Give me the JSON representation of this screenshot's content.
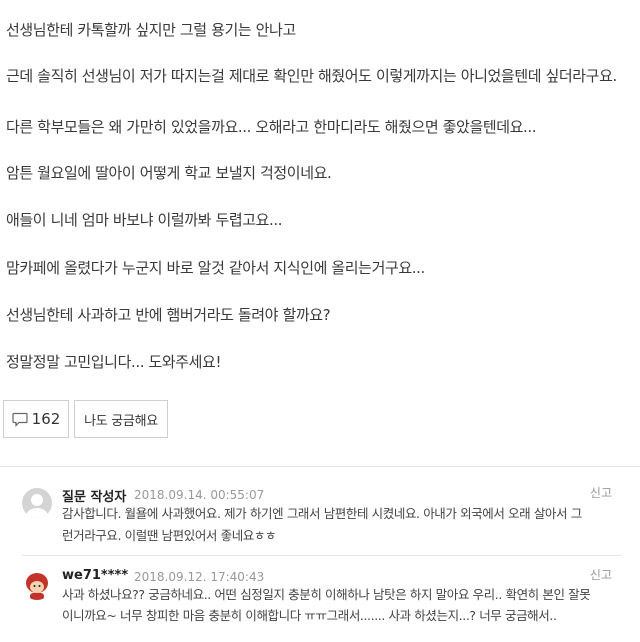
{
  "post": {
    "paragraphs": [
      "선생님한테 카톡할까 싶지만 그럴 용기는 안나고",
      "근데 솔직히 선생님이 저가 따지는걸 제대로 확인만 해줬어도 이렇게까지는 아니었을텐데 싶더라구요.",
      "다른 학부모들은 왜 가만히 있었을까요... 오해라고 한마디라도 해줬으면 좋았을텐데요...",
      "암튼 월요일에 딸아이 어떻게 학교 보낼지 걱정이네요.",
      "애들이 니네 엄마 바보냐 이럴까봐 두렵고요...",
      "맘카페에 올렸다가 누군지 바로 알것 같아서 지식인에 올리는거구요...",
      "선생님한테 사과하고 반에 햄버거라도 돌려야 할까요?",
      "정말정말 고민입니다... 도와주세요!"
    ]
  },
  "actions": {
    "like_icon": "speech-bubble-icon",
    "like_count": "162",
    "curious_label": "나도 궁금해요"
  },
  "comments": [
    {
      "author": "질문 작성자",
      "date": "2018.09.14. 00:55:07",
      "report": "신고",
      "avatar": "default-user-avatar",
      "lines": [
        "감사합니다. 월욜에 사과했어요. 제가 하기엔 그래서 남편한테 시켰네요. 아내가 외국에서 오래 살아서 그",
        "런거라구요. 이럴땐 남편있어서 좋네요ㅎㅎ"
      ]
    },
    {
      "author": "we71****",
      "date": "2018.09.12. 17:40:43",
      "report": "신고",
      "avatar": "character-avatar",
      "lines": [
        "사과 하셨나요?? 궁금하네요.. 어떤 심정일지 충분히 이해하나 남탓은 하지 말아요 우리.. 확연히 본인 잘못",
        "이니까요~ 너무 창피한 마음 충분히 이해합니다 ㅠㅠ그래서....... 사과 하셨는지...? 너무 궁금해서.."
      ]
    }
  ],
  "colors": {
    "text": "#3a3a3a",
    "meta": "#999999",
    "border": "#cfcfcf"
  }
}
